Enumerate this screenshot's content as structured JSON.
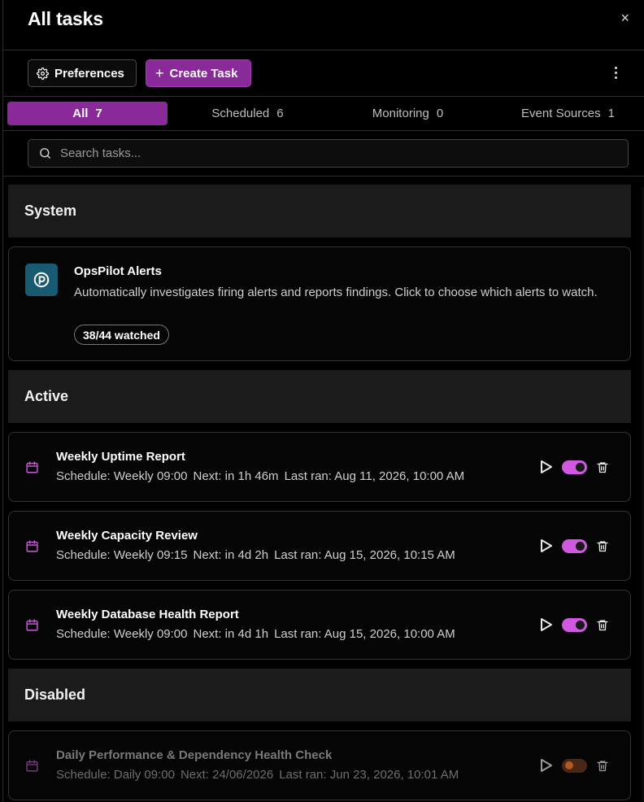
{
  "header": {
    "title": "All tasks",
    "close_symbol": "×"
  },
  "toolbar": {
    "preferences_label": "Preferences",
    "create_label": "Create Task"
  },
  "tabs": [
    {
      "label": "All",
      "count": "7",
      "active": true
    },
    {
      "label": "Scheduled",
      "count": "6",
      "active": false
    },
    {
      "label": "Monitoring",
      "count": "0",
      "active": false
    },
    {
      "label": "Event Sources",
      "count": "1",
      "active": false
    }
  ],
  "search": {
    "placeholder": "Search tasks..."
  },
  "sections": {
    "system": "System",
    "active": "Active",
    "disabled": "Disabled"
  },
  "system_task": {
    "name": "OpsPilot Alerts",
    "description": "Automatically investigates firing alerts and reports findings. Click to choose which alerts to watch.",
    "badge": "38/44 watched"
  },
  "active_tasks": [
    {
      "name": "Weekly Uptime Report",
      "schedule": "Schedule: Weekly 09:00",
      "next": "Next: in 1h 46m",
      "last_ran": "Last ran: Aug 11, 2026, 10:00 AM",
      "enabled": true
    },
    {
      "name": "Weekly Capacity Review",
      "schedule": "Schedule: Weekly 09:15",
      "next": "Next: in 4d 2h",
      "last_ran": "Last ran: Aug 15, 2026, 10:15 AM",
      "enabled": true
    },
    {
      "name": "Weekly Database Health Report",
      "schedule": "Schedule: Weekly 09:00",
      "next": "Next: in 4d 1h",
      "last_ran": "Last ran: Aug 15, 2026, 10:00 AM",
      "enabled": true
    }
  ],
  "disabled_tasks": [
    {
      "name": "Daily Performance & Dependency Health Check",
      "schedule": "Schedule: Daily 09:00",
      "next": "Next: 24/06/2026",
      "last_ran": "Last ran: Jun 23, 2026, 10:01 AM",
      "enabled": false
    }
  ],
  "colors": {
    "accent": "#8a2a9a",
    "toggle_on": "#d158e1",
    "icon_accent": "#d158e1",
    "system_logo": "#185a72"
  },
  "icons": {
    "close": "close-icon",
    "preferences": "gear-icon",
    "create": "plus-icon",
    "more": "kebab-menu-icon",
    "search": "search-icon",
    "calendar": "calendar-icon",
    "run": "play-icon",
    "delete": "trash-icon"
  }
}
